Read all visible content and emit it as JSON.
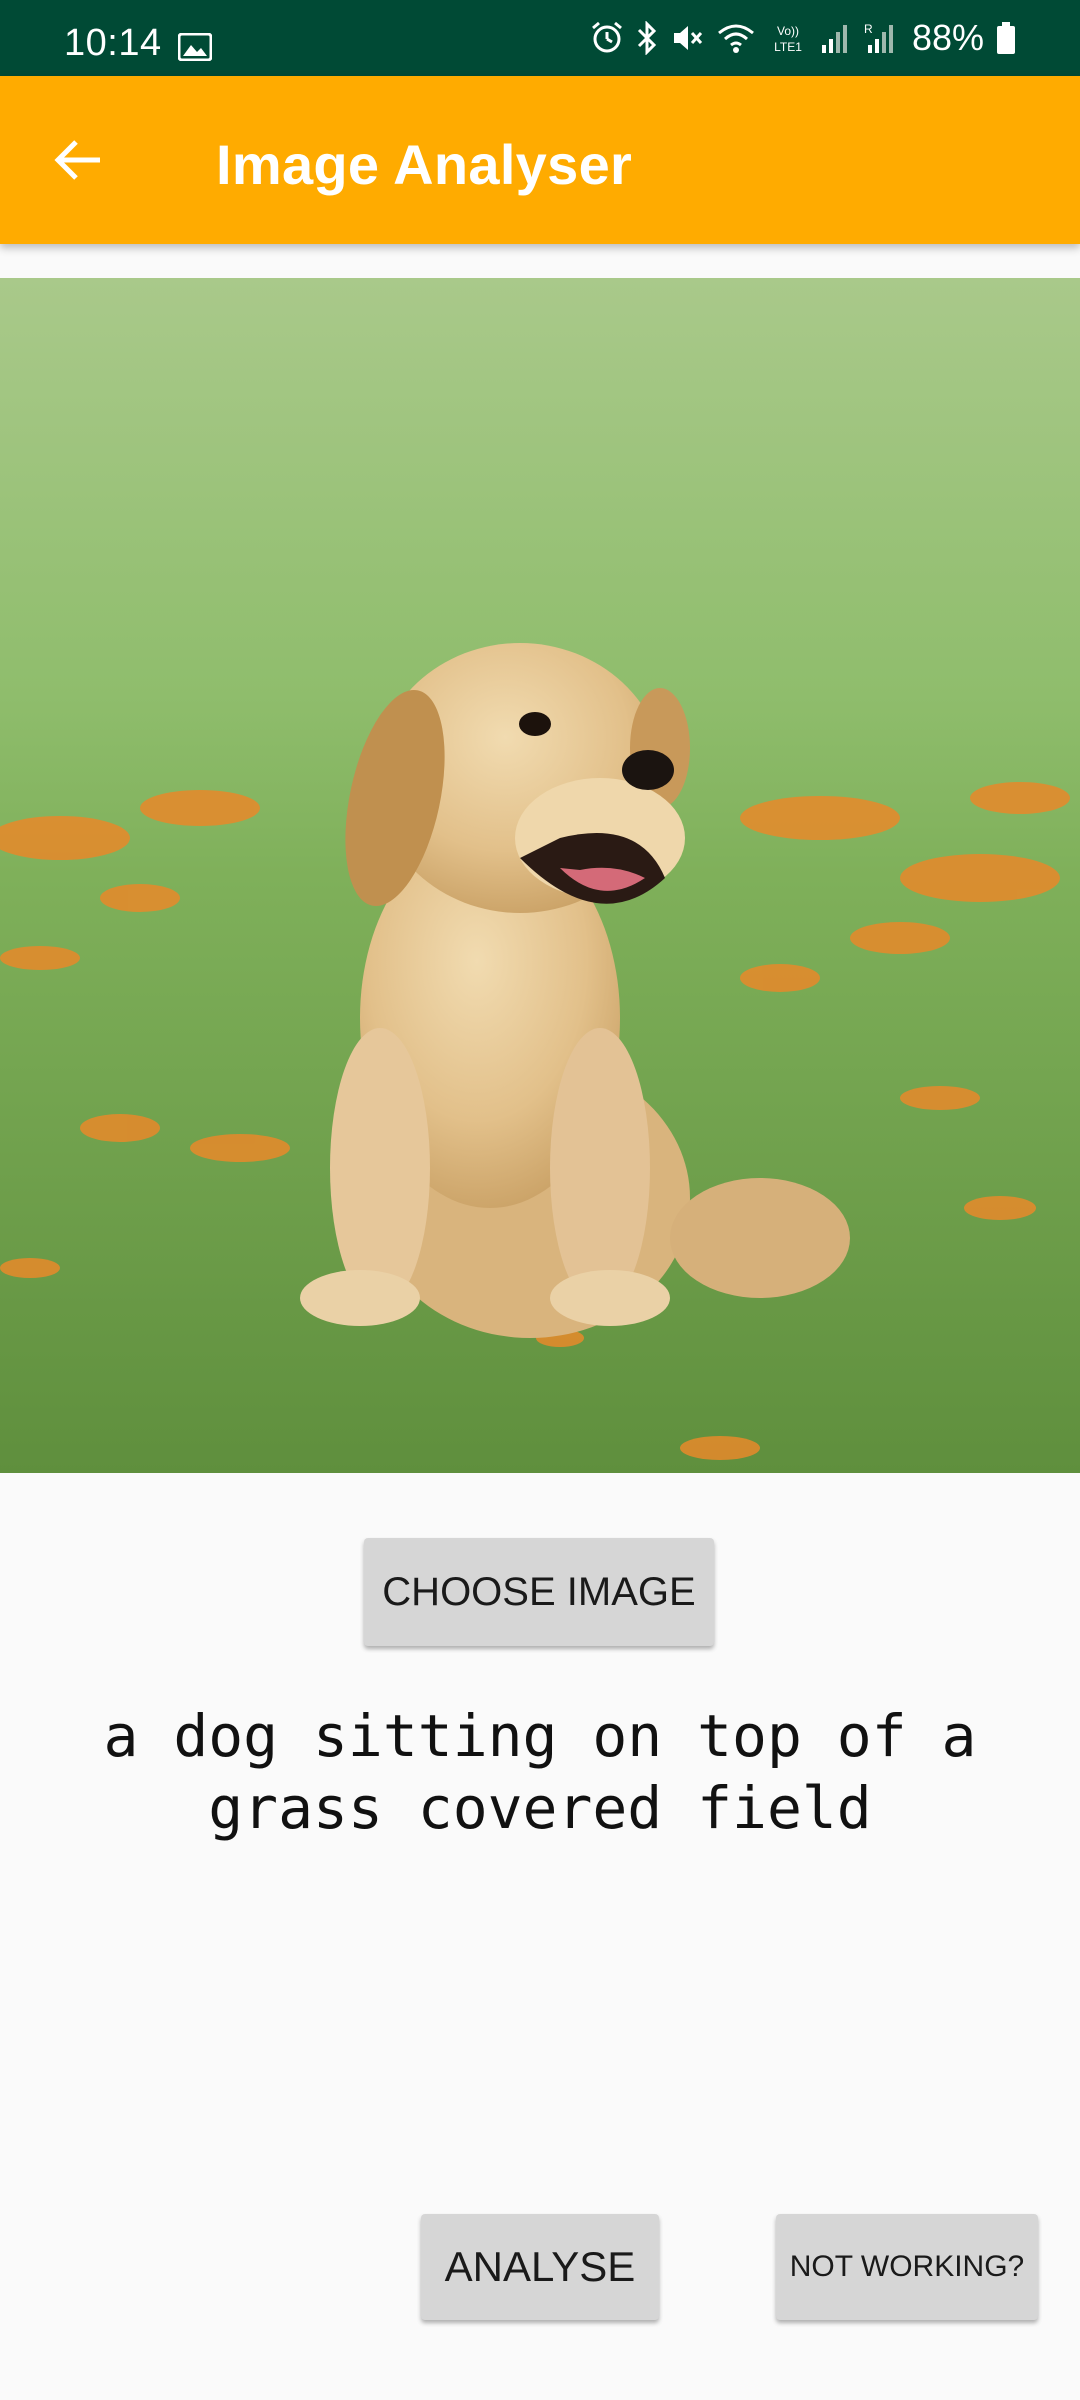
{
  "status_bar": {
    "time": "10:14",
    "battery": "88%",
    "icons": [
      "gallery-icon",
      "alarm-icon",
      "bluetooth-icon",
      "mute-icon",
      "wifi-icon",
      "volte-icon",
      "signal-icon",
      "roaming-signal-icon",
      "battery-icon"
    ]
  },
  "app_bar": {
    "title": "Image Analyser",
    "back_icon": "arrow-back-icon"
  },
  "image": {
    "subject": "puppy-photo"
  },
  "buttons": {
    "choose": "CHOOSE IMAGE",
    "analyse": "ANALYSE",
    "not_working": "NOT WORKING?"
  },
  "result": {
    "caption": "a dog sitting on top of a grass covered field"
  },
  "colors": {
    "status_bar": "#004a35",
    "app_bar": "#ffab00",
    "button": "#d6d6d6",
    "background": "#fafafa"
  }
}
